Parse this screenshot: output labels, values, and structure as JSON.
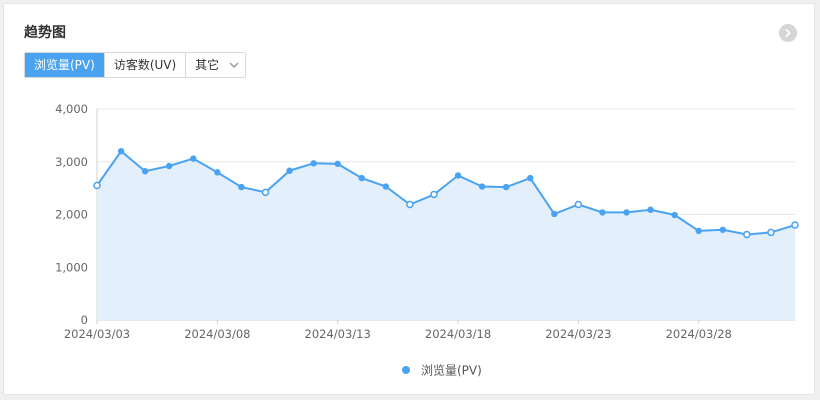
{
  "card": {
    "title": "趋势图",
    "more_icon": "chevron-right-icon"
  },
  "tabs": [
    {
      "label": "浏览量(PV)",
      "active": true
    },
    {
      "label": "访客数(UV)",
      "active": false
    },
    {
      "label": "其它",
      "active": false,
      "icon": "chevron-down-icon"
    }
  ],
  "colors": {
    "accent": "#4aa3f0",
    "line": "#4aa3f0",
    "area": "#e3effb",
    "grid": "#e8e8e8"
  },
  "chart_data": {
    "type": "area",
    "x": [
      "2024/03/03",
      "2024/03/04",
      "2024/03/05",
      "2024/03/06",
      "2024/03/07",
      "2024/03/08",
      "2024/03/09",
      "2024/03/10",
      "2024/03/11",
      "2024/03/12",
      "2024/03/13",
      "2024/03/14",
      "2024/03/15",
      "2024/03/16",
      "2024/03/17",
      "2024/03/18",
      "2024/03/19",
      "2024/03/20",
      "2024/03/21",
      "2024/03/22",
      "2024/03/23",
      "2024/03/24",
      "2024/03/25",
      "2024/03/26",
      "2024/03/27",
      "2024/03/28",
      "2024/03/29",
      "2024/03/30",
      "2024/03/31",
      "2024/04/01"
    ],
    "x_tick_labels": [
      "2024/03/03",
      "2024/03/08",
      "2024/03/13",
      "2024/03/18",
      "2024/03/23",
      "2024/03/28"
    ],
    "series": [
      {
        "name": "浏览量(PV)",
        "values": [
          2550,
          3200,
          2820,
          2920,
          3060,
          2800,
          2520,
          2420,
          2830,
          2970,
          2960,
          2690,
          2530,
          2190,
          2380,
          2740,
          2530,
          2520,
          2690,
          2010,
          2190,
          2040,
          2040,
          2090,
          1990,
          1690,
          1710,
          1620,
          1660,
          1800
        ],
        "hollow_points": [
          0,
          7,
          13,
          14,
          20,
          27,
          28,
          29
        ]
      }
    ],
    "ylim": [
      0,
      4000
    ],
    "y_ticks": [
      "4,000",
      "3,000",
      "2,000",
      "1,000",
      "0"
    ],
    "y_tick_values": [
      4000,
      3000,
      2000,
      1000,
      0
    ],
    "grid": true,
    "legend_position": "bottom-center"
  }
}
